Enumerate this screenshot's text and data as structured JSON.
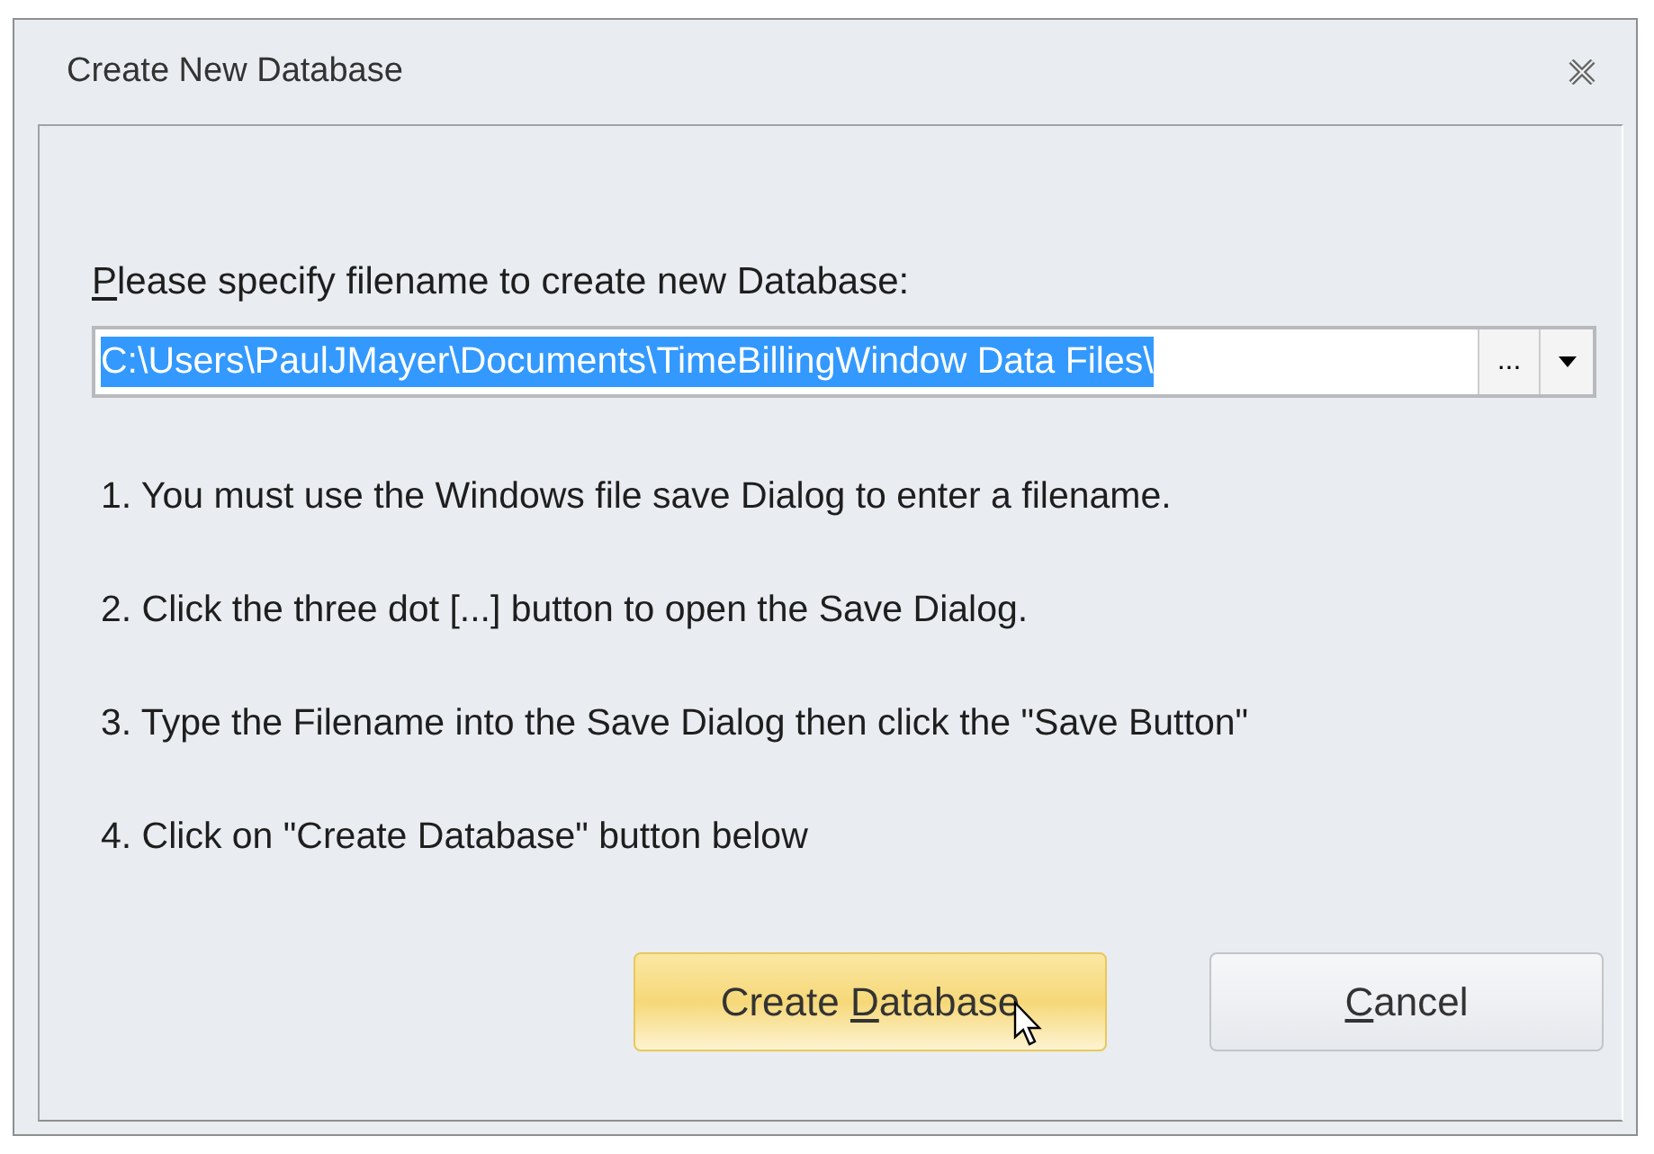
{
  "window": {
    "title": "Create New Database"
  },
  "prompt": {
    "key": "P",
    "after": "lease specify filename to create new Database:"
  },
  "filename_field": {
    "value": "C:\\Users\\PaulJMayer\\Documents\\TimeBillingWindow Data Files\\",
    "selected": true,
    "browse_label": "..."
  },
  "instructions": [
    "1. You must use the Windows file save Dialog to enter a filename.",
    "2. Click the three dot [...] button to open the Save Dialog.",
    "3. Type the Filename into the Save Dialog then click the \"Save Button\"",
    "4. Click on \"Create Database\" button below"
  ],
  "buttons": [
    {
      "before": "Create ",
      "key": "D",
      "after": "atabase",
      "hovered": true
    },
    {
      "key": "C",
      "after": "ancel",
      "hovered": false
    }
  ]
}
